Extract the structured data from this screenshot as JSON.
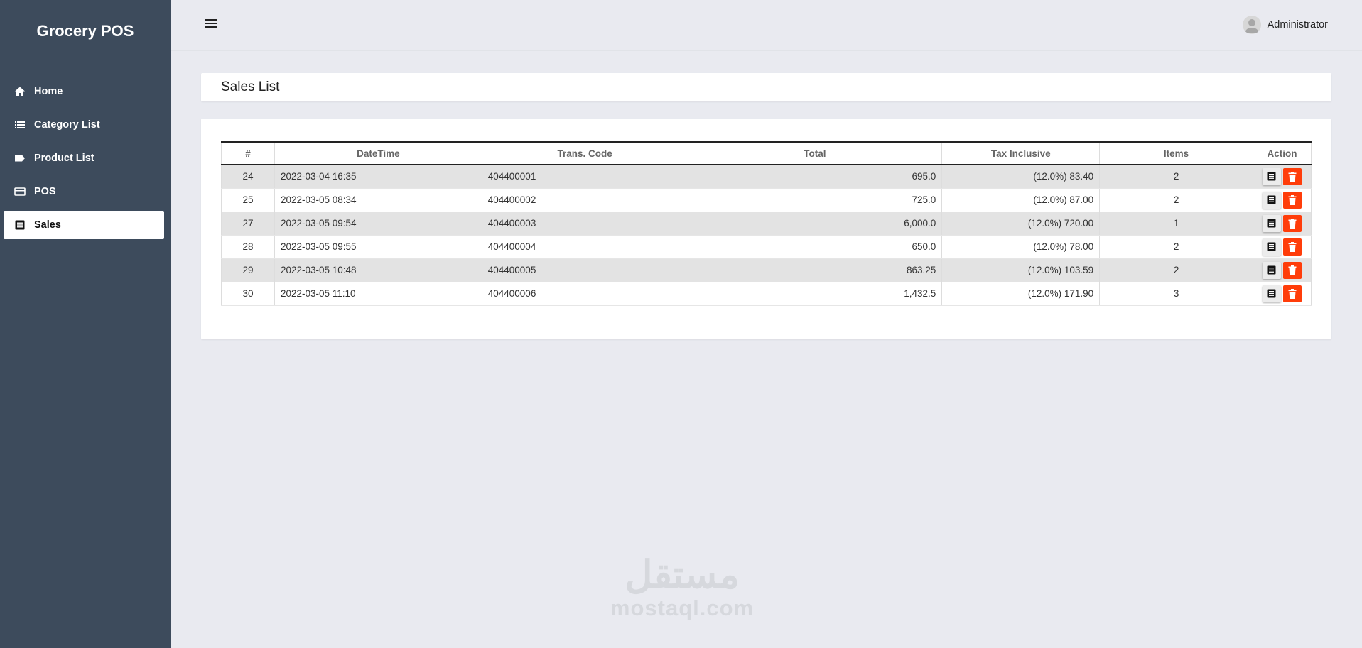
{
  "app": {
    "brand": "Grocery POS"
  },
  "sidebar": {
    "items": [
      {
        "label": "Home",
        "icon": "home-icon",
        "active": false
      },
      {
        "label": "Category List",
        "icon": "list-icon",
        "active": false
      },
      {
        "label": "Product List",
        "icon": "tag-icon",
        "active": false
      },
      {
        "label": "POS",
        "icon": "credit-card-icon",
        "active": false
      },
      {
        "label": "Sales",
        "icon": "receipt-icon",
        "active": true
      }
    ]
  },
  "topbar": {
    "user": "Administrator"
  },
  "page": {
    "title": "Sales List"
  },
  "table": {
    "headers": [
      "#",
      "DateTime",
      "Trans. Code",
      "Total",
      "Tax Inclusive",
      "Items",
      "Action"
    ],
    "rows": [
      {
        "id": "24",
        "datetime": "2022-03-04 16:35",
        "code": "404400001",
        "total": "695.0",
        "tax": "(12.0%) 83.40",
        "items": "2"
      },
      {
        "id": "25",
        "datetime": "2022-03-05 08:34",
        "code": "404400002",
        "total": "725.0",
        "tax": "(12.0%) 87.00",
        "items": "2"
      },
      {
        "id": "27",
        "datetime": "2022-03-05 09:54",
        "code": "404400003",
        "total": "6,000.0",
        "tax": "(12.0%) 720.00",
        "items": "1"
      },
      {
        "id": "28",
        "datetime": "2022-03-05 09:55",
        "code": "404400004",
        "total": "650.0",
        "tax": "(12.0%) 78.00",
        "items": "2"
      },
      {
        "id": "29",
        "datetime": "2022-03-05 10:48",
        "code": "404400005",
        "total": "863.25",
        "tax": "(12.0%) 103.59",
        "items": "2"
      },
      {
        "id": "30",
        "datetime": "2022-03-05 11:10",
        "code": "404400006",
        "total": "1,432.5",
        "tax": "(12.0%) 171.90",
        "items": "3"
      }
    ]
  },
  "watermark": {
    "arabic": "مستقل",
    "latin": "mostaql.com"
  },
  "colors": {
    "sidebar": "#3d4b5c",
    "background": "#e9eaf0",
    "delete": "#ff3d0a",
    "view": "#ececec"
  }
}
